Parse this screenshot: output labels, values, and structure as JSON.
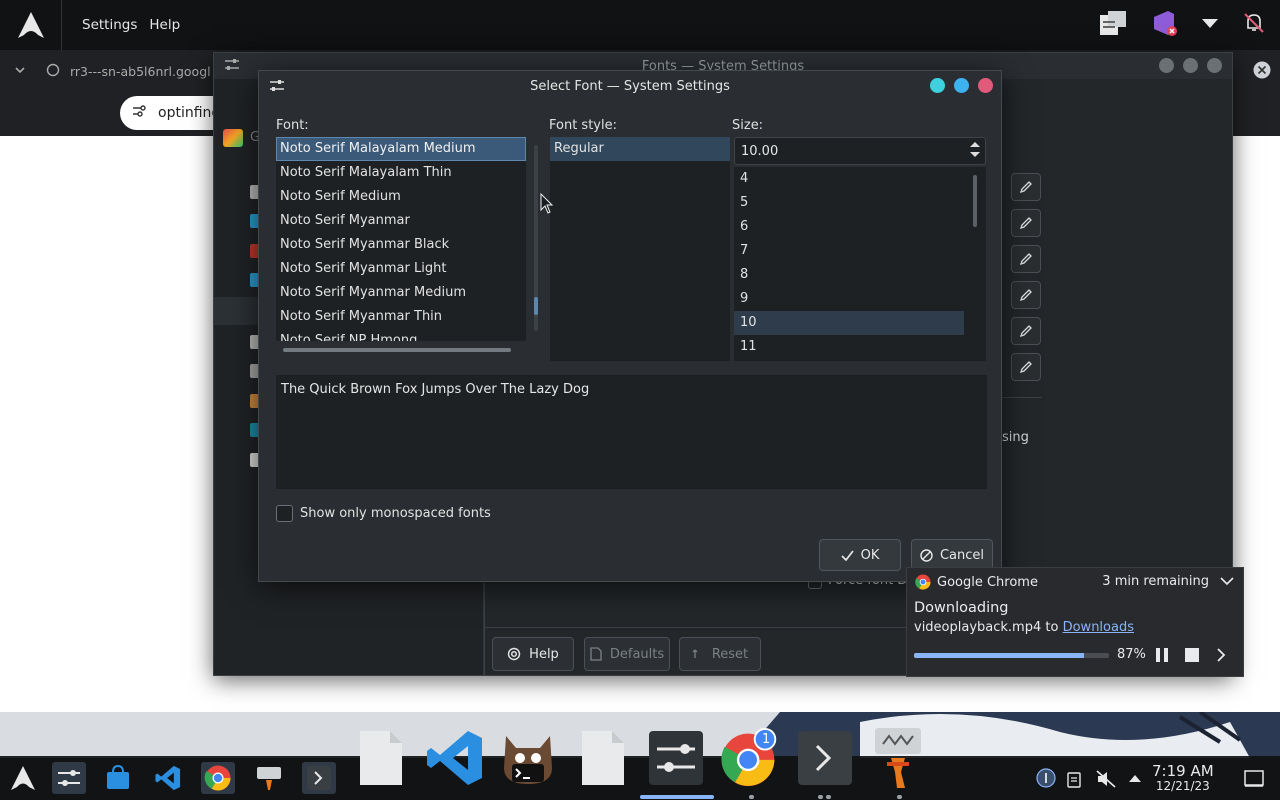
{
  "top_panel": {
    "menus": [
      "Settings",
      "Help"
    ],
    "icons": [
      "arch-logo-icon",
      "notes-icon",
      "visual-studio-icon",
      "dropdown-arrow-icon",
      "notifications-off-icon"
    ]
  },
  "chrome_bg": {
    "tab_title": "rr3---sn-ab5l6nrl.googl",
    "omnibox_text": "optinfinec"
  },
  "fonts_window": {
    "title": "Fonts — System Settings",
    "partial_sidebar_text": "G",
    "partial_content_text": "sing",
    "partial_checkbox_text": "Force font D",
    "help_label": "Help",
    "defaults_label": "Defaults",
    "reset_label": "Reset"
  },
  "dialog": {
    "title": "Select Font — System Settings",
    "font_label": "Font:",
    "style_label": "Font style:",
    "size_label": "Size:",
    "fonts": [
      "Noto Serif Malayalam Medium",
      "Noto Serif Malayalam Thin",
      "Noto Serif Medium",
      "Noto Serif Myanmar",
      "Noto Serif Myanmar Black",
      "Noto Serif Myanmar Light",
      "Noto Serif Myanmar Medium",
      "Noto Serif Myanmar Thin",
      "Noto Serif NP Hmong"
    ],
    "selected_font": "Noto Serif Malayalam Medium",
    "styles": [
      "Regular"
    ],
    "size_value": "10.00",
    "sizes": [
      "4",
      "5",
      "6",
      "7",
      "8",
      "9",
      "10",
      "11"
    ],
    "selected_size": "10",
    "preview_text": "The Quick Brown Fox Jumps Over The Lazy Dog",
    "monospace_label": "Show only monospaced fonts",
    "monospace_checked": false,
    "ok_label": "OK",
    "cancel_label": "Cancel"
  },
  "download": {
    "app": "Google Chrome",
    "remaining": "3 min remaining",
    "status": "Downloading",
    "file": "videoplayback.mp4",
    "to_text": "to",
    "dest": "Downloads",
    "progress_label": "87%",
    "progress": 0.87
  },
  "taskbar": {
    "time": "7:19 AM",
    "date": "12/21/23",
    "chrome_badge": "1"
  },
  "colors": {
    "accent": "#5d87ad",
    "close": "#e05a7a",
    "minimize": "#3fd0e0",
    "maximize": "#3eb2f0",
    "chrome_blue": "#8ab4f8"
  }
}
